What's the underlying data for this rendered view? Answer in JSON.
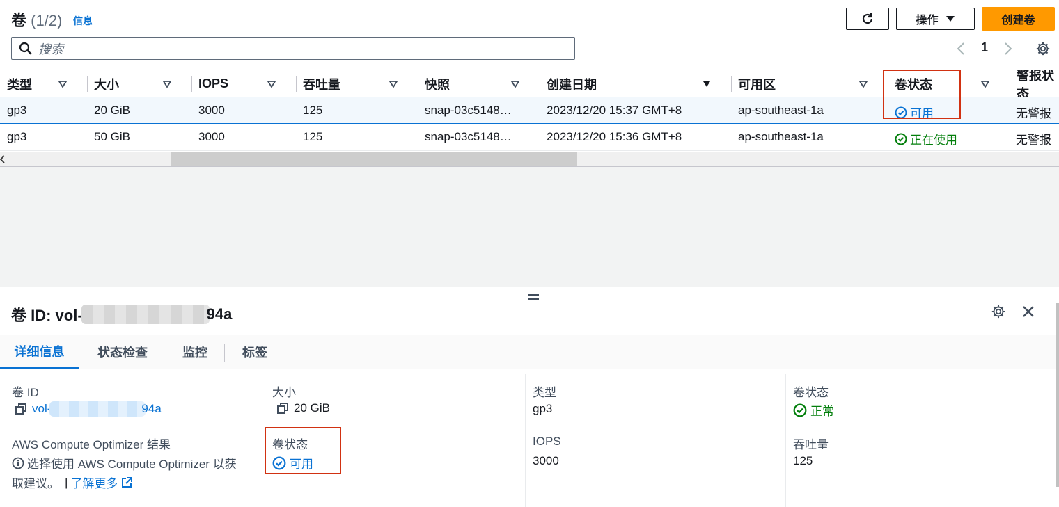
{
  "header": {
    "title": "卷",
    "count": "(1/2)",
    "info_link": "信息",
    "actions_label": "操作",
    "create_label": "创建卷",
    "search_placeholder": "搜索",
    "page_number": "1"
  },
  "table": {
    "columns": [
      "类型",
      "大小",
      "IOPS",
      "吞吐量",
      "快照",
      "创建日期",
      "可用区",
      "卷状态",
      "警报状态"
    ],
    "rows": [
      {
        "type": "gp3",
        "size": "20 GiB",
        "iops": "3000",
        "throughput": "125",
        "snapshot": "snap-03c5148…",
        "created": "2023/12/20 15:37 GMT+8",
        "az": "ap-southeast-1a",
        "state": "可用",
        "alarm": "无警报"
      },
      {
        "type": "gp3",
        "size": "50 GiB",
        "iops": "3000",
        "throughput": "125",
        "snapshot": "snap-03c5148…",
        "created": "2023/12/20 15:36 GMT+8",
        "az": "ap-southeast-1a",
        "state": "正在使用",
        "alarm": "无警报"
      }
    ]
  },
  "detail": {
    "title_prefix": "卷 ID: vol-",
    "title_suffix": "94a",
    "tabs": [
      "详细信息",
      "状态检查",
      "监控",
      "标签"
    ],
    "volume_id_label": "卷 ID",
    "volume_id_prefix": "vol-",
    "volume_id_suffix": "94a",
    "optimizer_label": "AWS Compute Optimizer 结果",
    "optimizer_text_1": "选择使用 AWS Compute Optimizer 以获",
    "optimizer_text_2": "取建议。",
    "learn_more": "了解更多",
    "size_label": "大小",
    "size_value": "20 GiB",
    "state_label": "卷状态",
    "state_value": "可用",
    "type_label": "类型",
    "type_value": "gp3",
    "iops_label": "IOPS",
    "iops_value": "3000",
    "status_label": "卷状态",
    "status_value": "正常",
    "throughput_label": "吞吐量",
    "throughput_value": "125"
  },
  "colors": {
    "accent": "#0972d3",
    "success": "#037f0c",
    "primary_button": "#ff9900",
    "highlight_box": "#d13212"
  },
  "icons": [
    "refresh-icon",
    "caret-down-icon",
    "search-icon",
    "chevron-left-icon",
    "chevron-right-icon",
    "settings-icon",
    "sort-icon",
    "status-available-icon",
    "status-in-use-icon",
    "copy-icon",
    "info-icon",
    "external-link-icon",
    "close-icon",
    "drag-handle-icon"
  ]
}
